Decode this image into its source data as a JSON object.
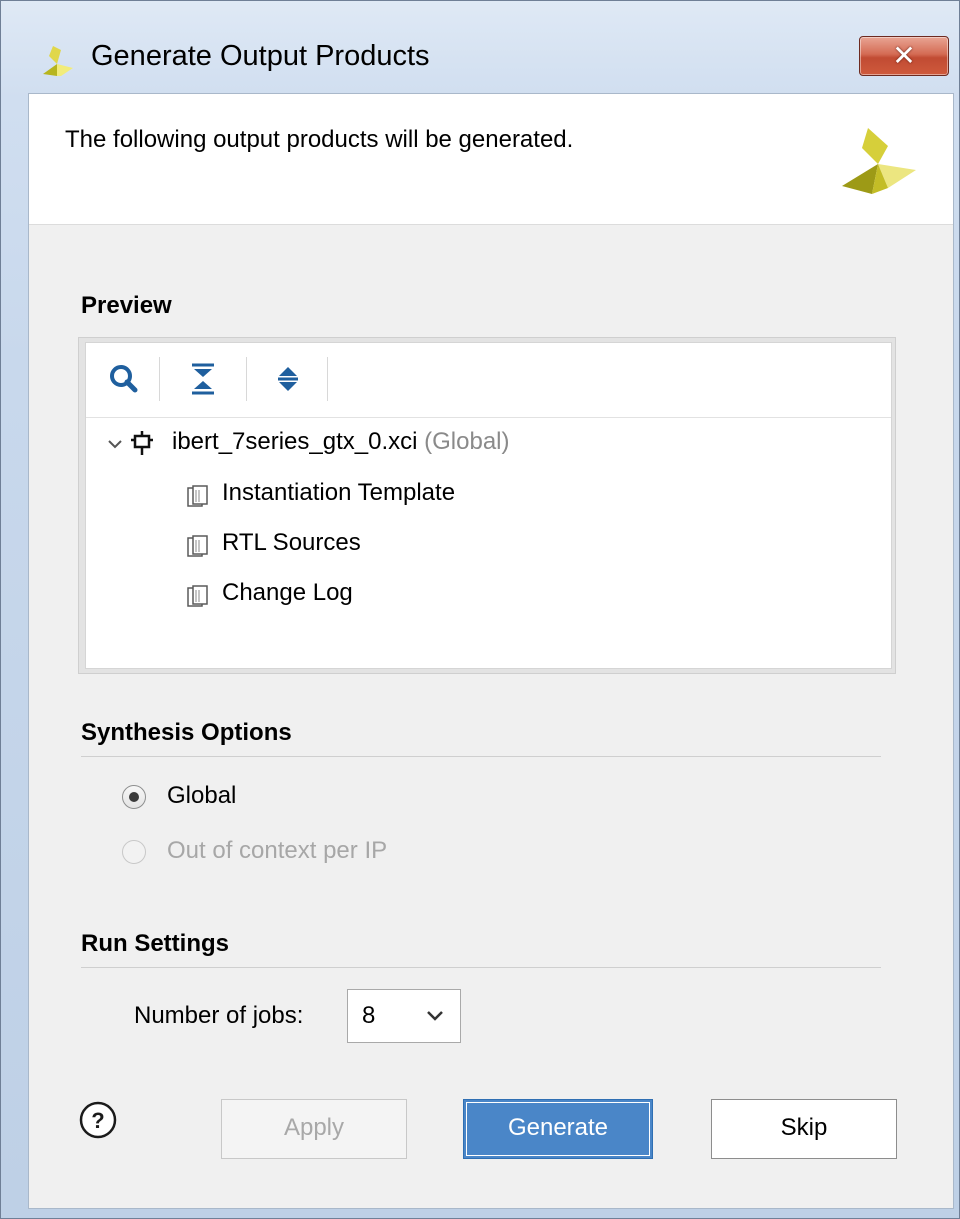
{
  "window": {
    "title": "Generate Output Products",
    "close_glyph": "✕",
    "logo_icon": "xilinx-logo-icon"
  },
  "header": {
    "message": "The following output products will be generated."
  },
  "preview": {
    "label": "Preview",
    "toolbar": [
      "search-icon",
      "collapse-all-icon",
      "expand-all-icon"
    ],
    "root": {
      "name": "ibert_7series_gtx_0.xci",
      "scope": "(Global)"
    },
    "children": [
      "Instantiation Template",
      "RTL Sources",
      "Change Log"
    ]
  },
  "synthesis": {
    "label": "Synthesis Options",
    "options": [
      {
        "label": "Global",
        "checked": true,
        "enabled": true
      },
      {
        "label": "Out of context per IP",
        "checked": false,
        "enabled": false
      }
    ]
  },
  "run_settings": {
    "label": "Run Settings",
    "jobs_label": "Number of jobs:",
    "jobs_value": "8"
  },
  "buttons": {
    "help": "?",
    "apply": "Apply",
    "generate": "Generate",
    "skip": "Skip"
  },
  "colors": {
    "primary_button": "#4a86c8",
    "close_button": "#c14b33"
  }
}
